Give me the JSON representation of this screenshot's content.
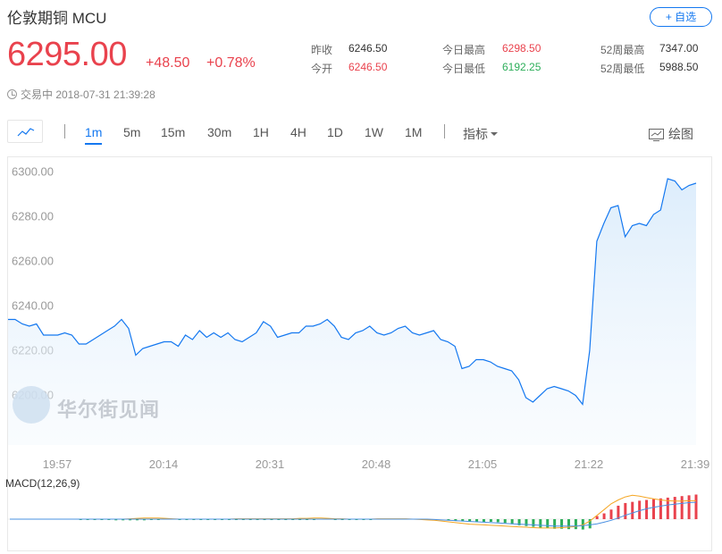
{
  "header": {
    "title": "伦敦期铜  MCU",
    "watch_label": "+ 自选",
    "price": "6295.00",
    "change": "+48.50",
    "change_pct": "+0.78%",
    "status": "交易中 2018-07-31 21:39:28"
  },
  "stats": {
    "prev_close_label": "昨收",
    "prev_close": "6246.50",
    "open_label": "今开",
    "open": "6246.50",
    "high_label": "今日最高",
    "high": "6298.50",
    "low_label": "今日最低",
    "low": "6192.25",
    "w52_high_label": "52周最高",
    "w52_high": "7347.00",
    "w52_low_label": "52周最低",
    "w52_low": "5988.50"
  },
  "toolbar": {
    "tabs": [
      "1m",
      "5m",
      "15m",
      "30m",
      "1H",
      "4H",
      "1D",
      "1W",
      "1M"
    ],
    "active_tab": "1m",
    "indicator_label": "指标",
    "draw_label": "绘图"
  },
  "watermark": "华尔街见闻",
  "colors": {
    "up": "#e9424d",
    "down": "#2dae5a",
    "line": "#1478f0",
    "accent": "#1478f0"
  },
  "chart_data": [
    {
      "type": "area",
      "ylim": [
        6185,
        6305
      ],
      "y_ticks": [
        "6300.00",
        "6280.00",
        "6260.00",
        "6240.00",
        "6220.00",
        "6200.00"
      ],
      "y_tick_values": [
        6300,
        6280,
        6260,
        6240,
        6220,
        6200
      ],
      "x_ticks": [
        "19:57",
        "20:14",
        "20:31",
        "20:48",
        "21:05",
        "21:22",
        "21:39"
      ],
      "series": [
        {
          "values": [
            6234,
            6234,
            6232,
            6231,
            6232,
            6227,
            6227,
            6227,
            6228,
            6227,
            6223,
            6223,
            6225,
            6227,
            6229,
            6231,
            6234,
            6230,
            6218,
            6221,
            6222,
            6223,
            6224,
            6224,
            6222,
            6227,
            6225,
            6229,
            6226,
            6228,
            6226,
            6228,
            6225,
            6224,
            6226,
            6228,
            6233,
            6231,
            6226,
            6227,
            6228,
            6228,
            6231,
            6231,
            6232,
            6234,
            6231,
            6226,
            6225,
            6228,
            6229,
            6231,
            6228,
            6227,
            6228,
            6230,
            6231,
            6228,
            6227,
            6228,
            6229,
            6225,
            6224,
            6222,
            6212,
            6213,
            6216,
            6216,
            6215,
            6213,
            6212,
            6211,
            6207,
            6199,
            6197,
            6200,
            6203,
            6204,
            6203,
            6202,
            6200,
            6196,
            6220,
            6269,
            6277,
            6284,
            6285,
            6271,
            6276,
            6277,
            6276,
            6281,
            6283,
            6297,
            6296,
            6292,
            6294,
            6295
          ]
        }
      ]
    },
    {
      "type": "bar",
      "title": "MACD(12,26,9)",
      "bars": [
        0,
        0,
        0,
        0,
        0,
        0,
        0,
        0,
        0,
        0,
        -0.2,
        -0.2,
        -0.2,
        -0.2,
        -0.2,
        -0.3,
        -0.3,
        -0.3,
        -0.3,
        -0.3,
        -0.2,
        -0.2,
        0,
        0,
        -0.2,
        -0.2,
        -0.2,
        -0.2,
        -0.2,
        -0.2,
        -0.1,
        -0.1,
        -0.1,
        -0.1,
        -0.1,
        -0.1,
        -0.1,
        -0.1,
        -0.1,
        -0.1,
        -0.1,
        -0.1,
        -0.1,
        -0.1,
        0,
        0,
        -0.1,
        -0.1,
        -0.2,
        -0.1,
        -0.1,
        -0.1,
        0,
        0,
        0,
        0,
        0,
        0,
        0,
        0,
        0,
        0,
        -0.2,
        -0.4,
        -0.6,
        -0.7,
        -0.7,
        -0.7,
        -0.7,
        -0.8,
        -1.0,
        -1.3,
        -1.6,
        -1.8,
        -2.0,
        -2.2,
        -2.3,
        -2.5,
        -2.5,
        -2.6,
        -2.6,
        -2.7,
        -2.4,
        0.8,
        1.5,
        2.5,
        3.5,
        4.2,
        4.5,
        4.8,
        5.0,
        5.2,
        5.4,
        5.6,
        5.8,
        6.0,
        6.2,
        6.4
      ],
      "dif": [
        0,
        0,
        0,
        0,
        0,
        0,
        0,
        0,
        0,
        0,
        0,
        0,
        0,
        0,
        0,
        0,
        0,
        0.1,
        0.2,
        0.3,
        0.3,
        0.3,
        0.2,
        0.1,
        0,
        0,
        0,
        0,
        0,
        0,
        0,
        0,
        0.1,
        0.1,
        0.1,
        0.1,
        0.1,
        0.1,
        0.1,
        0.1,
        0.1,
        0.2,
        0.2,
        0.3,
        0.3,
        0.2,
        0.1,
        0.1,
        0,
        0,
        0,
        0,
        0.1,
        0.1,
        0.1,
        0.1,
        0.1,
        0,
        -0.1,
        -0.2,
        -0.3,
        -0.5,
        -0.7,
        -0.9,
        -1.1,
        -1.3,
        -1.4,
        -1.5,
        -1.6,
        -1.7,
        -1.8,
        -1.9,
        -2.0,
        -2.1,
        -2.2,
        -2.3,
        -2.3,
        -2.3,
        -2.2,
        -2.1,
        -1.9,
        -1.5,
        -0.5,
        1.0,
        2.5,
        4.0,
        5.0,
        5.8,
        6.2,
        6.0,
        5.6,
        5.3,
        5.0,
        4.8,
        4.7,
        4.7,
        4.8,
        4.8
      ],
      "dea": [
        0,
        0,
        0,
        0,
        0,
        0,
        0,
        0,
        0,
        0,
        0,
        0,
        0,
        0,
        0,
        0,
        0,
        0,
        0,
        0,
        0,
        0,
        0,
        0,
        0,
        0,
        0,
        0,
        0,
        0,
        0,
        0,
        0,
        0,
        0,
        0,
        0,
        0,
        0,
        0,
        0,
        0,
        0,
        0,
        0,
        0,
        0,
        0,
        0,
        0,
        0,
        0,
        0,
        0,
        0,
        0,
        0,
        0,
        0,
        0,
        -0.1,
        -0.2,
        -0.3,
        -0.4,
        -0.5,
        -0.6,
        -0.7,
        -0.8,
        -0.9,
        -1.0,
        -1.1,
        -1.2,
        -1.3,
        -1.4,
        -1.5,
        -1.6,
        -1.7,
        -1.8,
        -1.8,
        -1.8,
        -1.8,
        -1.7,
        -1.5,
        -1.2,
        -0.8,
        -0.3,
        0.3,
        1.0,
        1.6,
        2.2,
        2.7,
        3.1,
        3.4,
        3.7,
        3.9,
        4.1,
        4.3,
        4.4
      ]
    }
  ]
}
